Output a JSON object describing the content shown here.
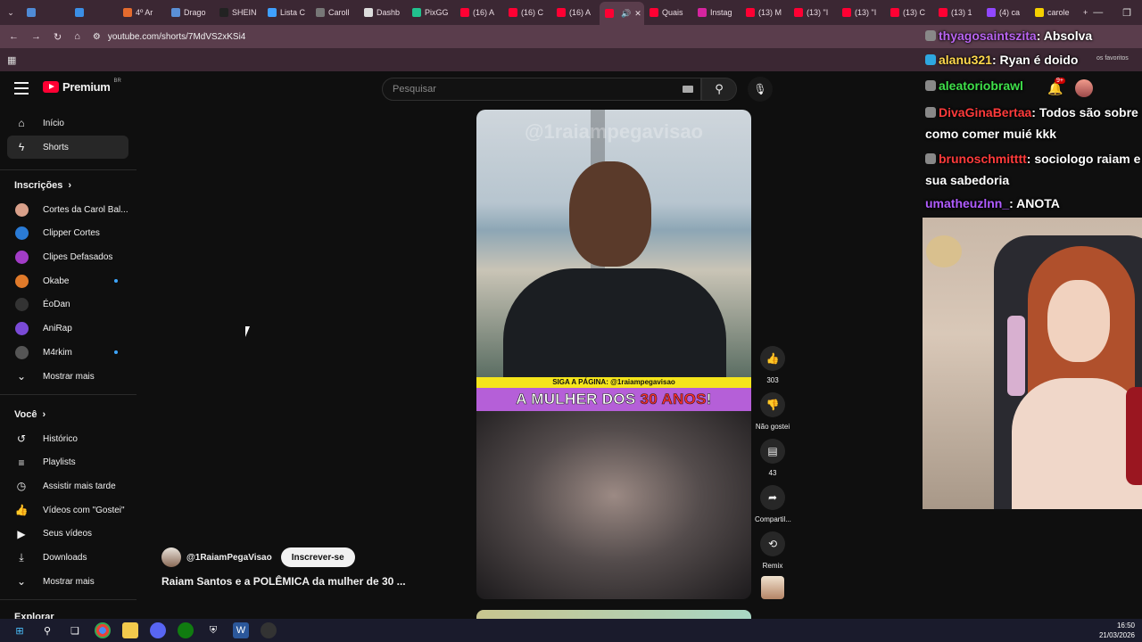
{
  "browser": {
    "tabs": [
      {
        "label": "",
        "color": "#4f8bd6"
      },
      {
        "label": "",
        "color": "#3b8fe6"
      },
      {
        "label": "4º Ar",
        "color": "#e56b2e"
      },
      {
        "label": "Drago",
        "color": "#5a8fd6"
      },
      {
        "label": "SHEIN",
        "color": "#222222"
      },
      {
        "label": "Lista C",
        "color": "#3fa0ff"
      },
      {
        "label": "Caroll",
        "color": "#777777"
      },
      {
        "label": "Dashb",
        "color": "#dddddd"
      },
      {
        "label": "PixGG",
        "color": "#21c28e"
      },
      {
        "label": "(16) A",
        "color": "#ff0033"
      },
      {
        "label": "(16) C",
        "color": "#ff0033"
      },
      {
        "label": "(16) A",
        "color": "#ff0033"
      },
      {
        "label": "",
        "color": "#ff0033",
        "active": true
      },
      {
        "label": "Quais",
        "color": "#ff0033"
      },
      {
        "label": "Instag",
        "color": "#d6249f"
      },
      {
        "label": "(13) M",
        "color": "#ff0033"
      },
      {
        "label": "(13) \"I",
        "color": "#ff0033"
      },
      {
        "label": "(13) \"I",
        "color": "#ff0033"
      },
      {
        "label": "(13) C",
        "color": "#ff0033"
      },
      {
        "label": "(13) 1",
        "color": "#ff0033"
      },
      {
        "label": "(4) ca",
        "color": "#9147ff"
      },
      {
        "label": "carole",
        "color": "#f5d000"
      }
    ],
    "new_tab": "+",
    "url": "youtube.com/shorts/7MdVS2xKSi4"
  },
  "youtube": {
    "logo_text": "Premium",
    "logo_region": "BR",
    "search_placeholder": "Pesquisar",
    "sidebar": {
      "main": [
        {
          "label": "Início",
          "icon": "home-icon",
          "glyph": "⌂"
        },
        {
          "label": "Shorts",
          "icon": "shorts-icon",
          "glyph": "ϟ",
          "active": true
        }
      ],
      "subs_header": "Inscrições",
      "subs": [
        {
          "label": "Cortes da Carol Bal...",
          "color": "#d9a08a",
          "dot": false
        },
        {
          "label": "Clipper Cortes",
          "color": "#2a7bd6",
          "dot": false
        },
        {
          "label": "Clipes Defasados",
          "color": "#a23cc7",
          "dot": false
        },
        {
          "label": "Okabe",
          "color": "#e07a2a",
          "dot": true
        },
        {
          "label": "ÉoDan",
          "color": "#333333",
          "dot": false
        },
        {
          "label": "AniRap",
          "color": "#7a4ad6",
          "dot": false
        },
        {
          "label": "M4rkim",
          "color": "#555555",
          "dot": true
        }
      ],
      "subs_more": "Mostrar mais",
      "you_header": "Você",
      "you": [
        {
          "label": "Histórico",
          "icon": "history-icon",
          "glyph": "↺"
        },
        {
          "label": "Playlists",
          "icon": "playlists-icon",
          "glyph": "≡"
        },
        {
          "label": "Assistir mais tarde",
          "icon": "watch-later-icon",
          "glyph": "◷"
        },
        {
          "label": "Vídeos com \"Gostei\"",
          "icon": "liked-icon",
          "glyph": "👍"
        },
        {
          "label": "Seus vídeos",
          "icon": "your-videos-icon",
          "glyph": "▶"
        },
        {
          "label": "Downloads",
          "icon": "downloads-icon",
          "glyph": "⤓"
        }
      ],
      "you_more": "Mostrar mais",
      "explore_header": "Explorar"
    },
    "short": {
      "watermark": "@1raiampegavisao",
      "banner_small": "SIGA A PÁGINA: @1raiampegavisao",
      "banner_big_a": "A MULHER DOS ",
      "banner_big_b": "30 ANOS",
      "banner_big_c": "!",
      "channel": "@1RaiamPegaVisao",
      "subscribe": "Inscrever-se",
      "title": "Raiam Santos e a POLÊMICA da mulher de 30 ..."
    },
    "actions": [
      {
        "icon": "like-icon",
        "glyph": "👍",
        "label": "303"
      },
      {
        "icon": "dislike-icon",
        "glyph": "👎",
        "label": "Não gostei"
      },
      {
        "icon": "comments-icon",
        "glyph": "▤",
        "label": "43"
      },
      {
        "icon": "share-icon",
        "glyph": "➦",
        "label": "Compartil..."
      },
      {
        "icon": "remix-icon",
        "glyph": "⟲",
        "label": "Remix"
      }
    ],
    "notif_count": "9+"
  },
  "chat": [
    {
      "user": "thyagosaintszita",
      "color": "#b964f0",
      "text": ": Absolva"
    },
    {
      "user": "alanu321",
      "color": "#ffd84d",
      "text": ": Ryan é doido"
    },
    {
      "user": "aleatoriobrawl",
      "color": "#3fe04a",
      "text": ""
    },
    {
      "user": "DivaGinaBertaa",
      "color": "#ff3b3b",
      "text": ": Todos são sobre como comer muié kkk"
    },
    {
      "user": "brunoschmitttt",
      "color": "#ff3b3b",
      "text": ": sociologo raiam e sua sabedoria"
    },
    {
      "user": "umatheuzlnn_",
      "color": "#b05cff",
      "text": ": ANOTA"
    }
  ],
  "favs_note": "os favoritos",
  "taskbar": {
    "time": "16:50",
    "date": "21/03/2026"
  }
}
